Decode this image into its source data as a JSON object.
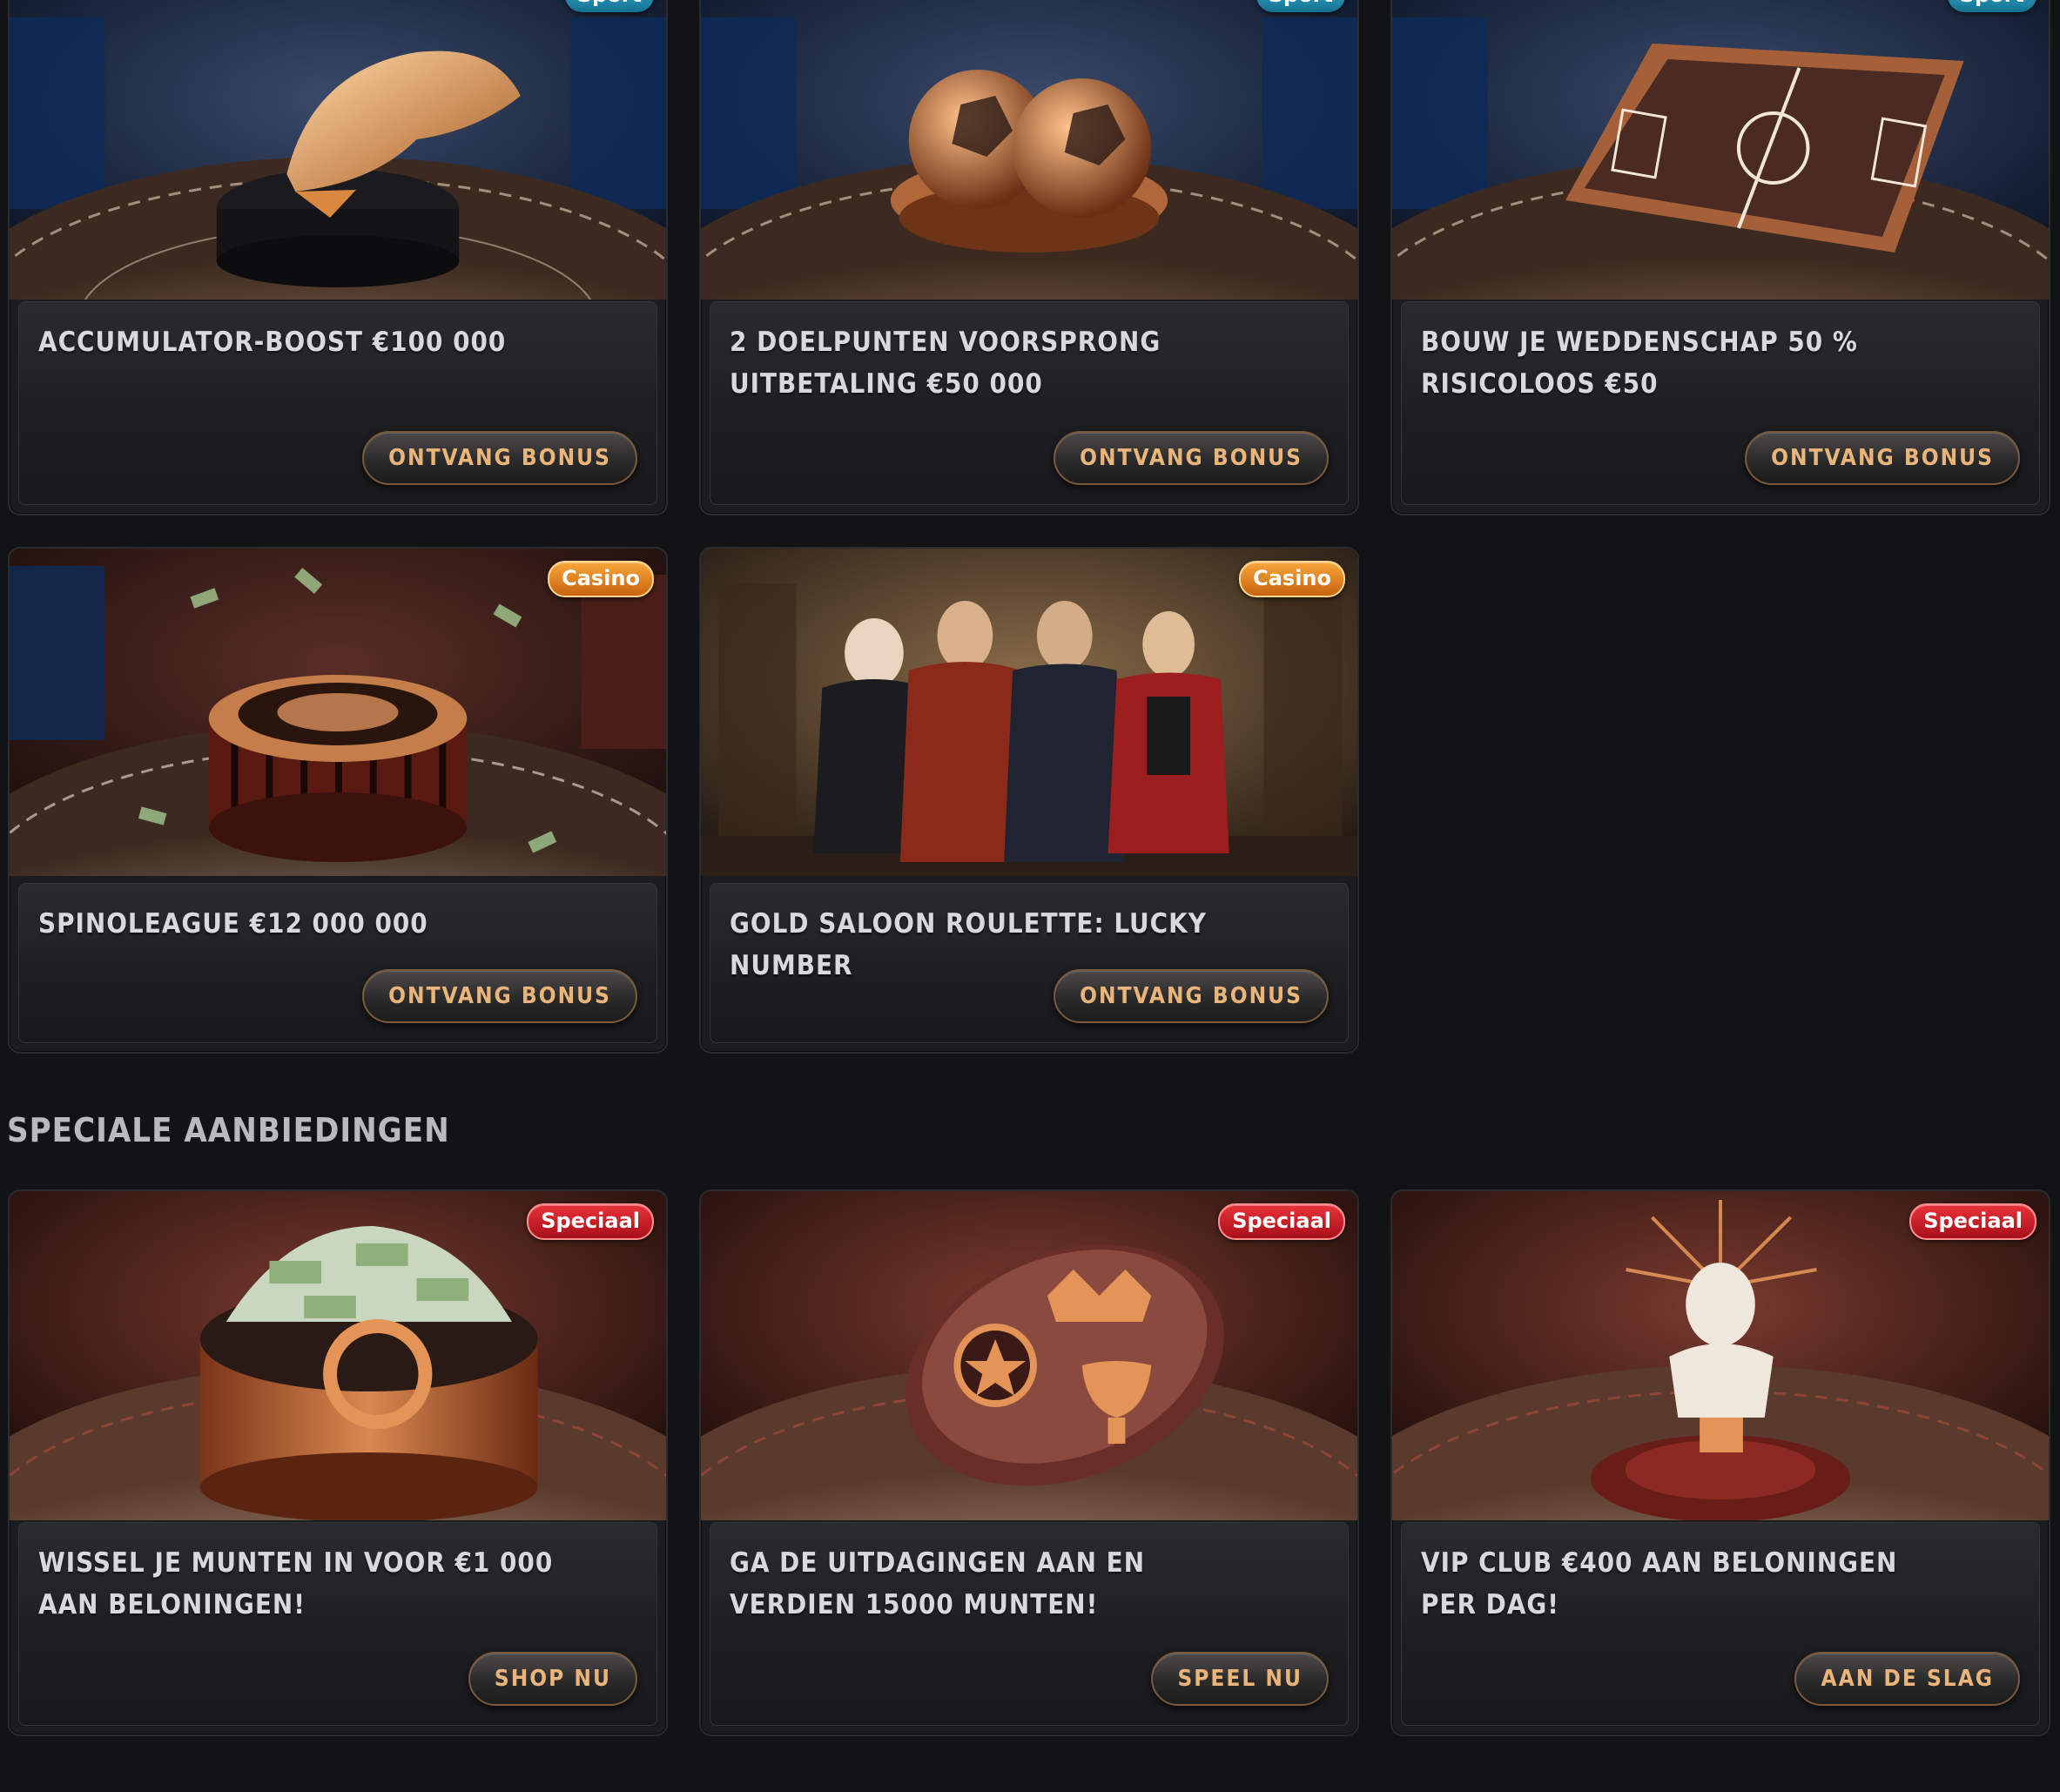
{
  "promotions": [
    {
      "category": "Sport",
      "title": "Accumulator-boost €100 000",
      "button": "Ontvang bonus"
    },
    {
      "category": "Sport",
      "title": "2 doelpunten voorsprong uitbetaling €50 000",
      "button": "Ontvang bonus"
    },
    {
      "category": "Sport",
      "title": "Bouw je weddenschap 50 % risicoloos €50",
      "button": "Ontvang bonus"
    },
    {
      "category": "Casino",
      "title": "SpinoLeague €12 000 000",
      "button": "Ontvang bonus"
    },
    {
      "category": "Casino",
      "title": "Gold Saloon Roulette: Lucky Number",
      "button": "Ontvang bonus"
    }
  ],
  "special_section": {
    "title": "Speciale aanbiedingen",
    "offers": [
      {
        "category": "Speciaal",
        "title": "Wissel je munten in voor €1 000 aan beloningen!",
        "button": "Shop nu"
      },
      {
        "category": "Speciaal",
        "title": "Ga de uitdagingen aan en verdien 15000 munten!",
        "button": "Speel nu"
      },
      {
        "category": "Speciaal",
        "title": "VIP Club €400 aan beloningen per dag!",
        "button": "Aan de slag"
      }
    ]
  },
  "colors": {
    "background": "#121315",
    "button_text": "#e9b57a",
    "sport_badge": "#2a9cc0",
    "casino_badge": "#e8861f",
    "special_badge": "#d11f28"
  },
  "images": [
    "golden-boot-trophy-image",
    "copper-football-bowl-image",
    "tactics-board-image",
    "roulette-wheel-money-image",
    "four-characters-saloon-image",
    "money-stack-exchange-image",
    "badges-crown-trophy-image",
    "vip-bust-statue-image"
  ]
}
